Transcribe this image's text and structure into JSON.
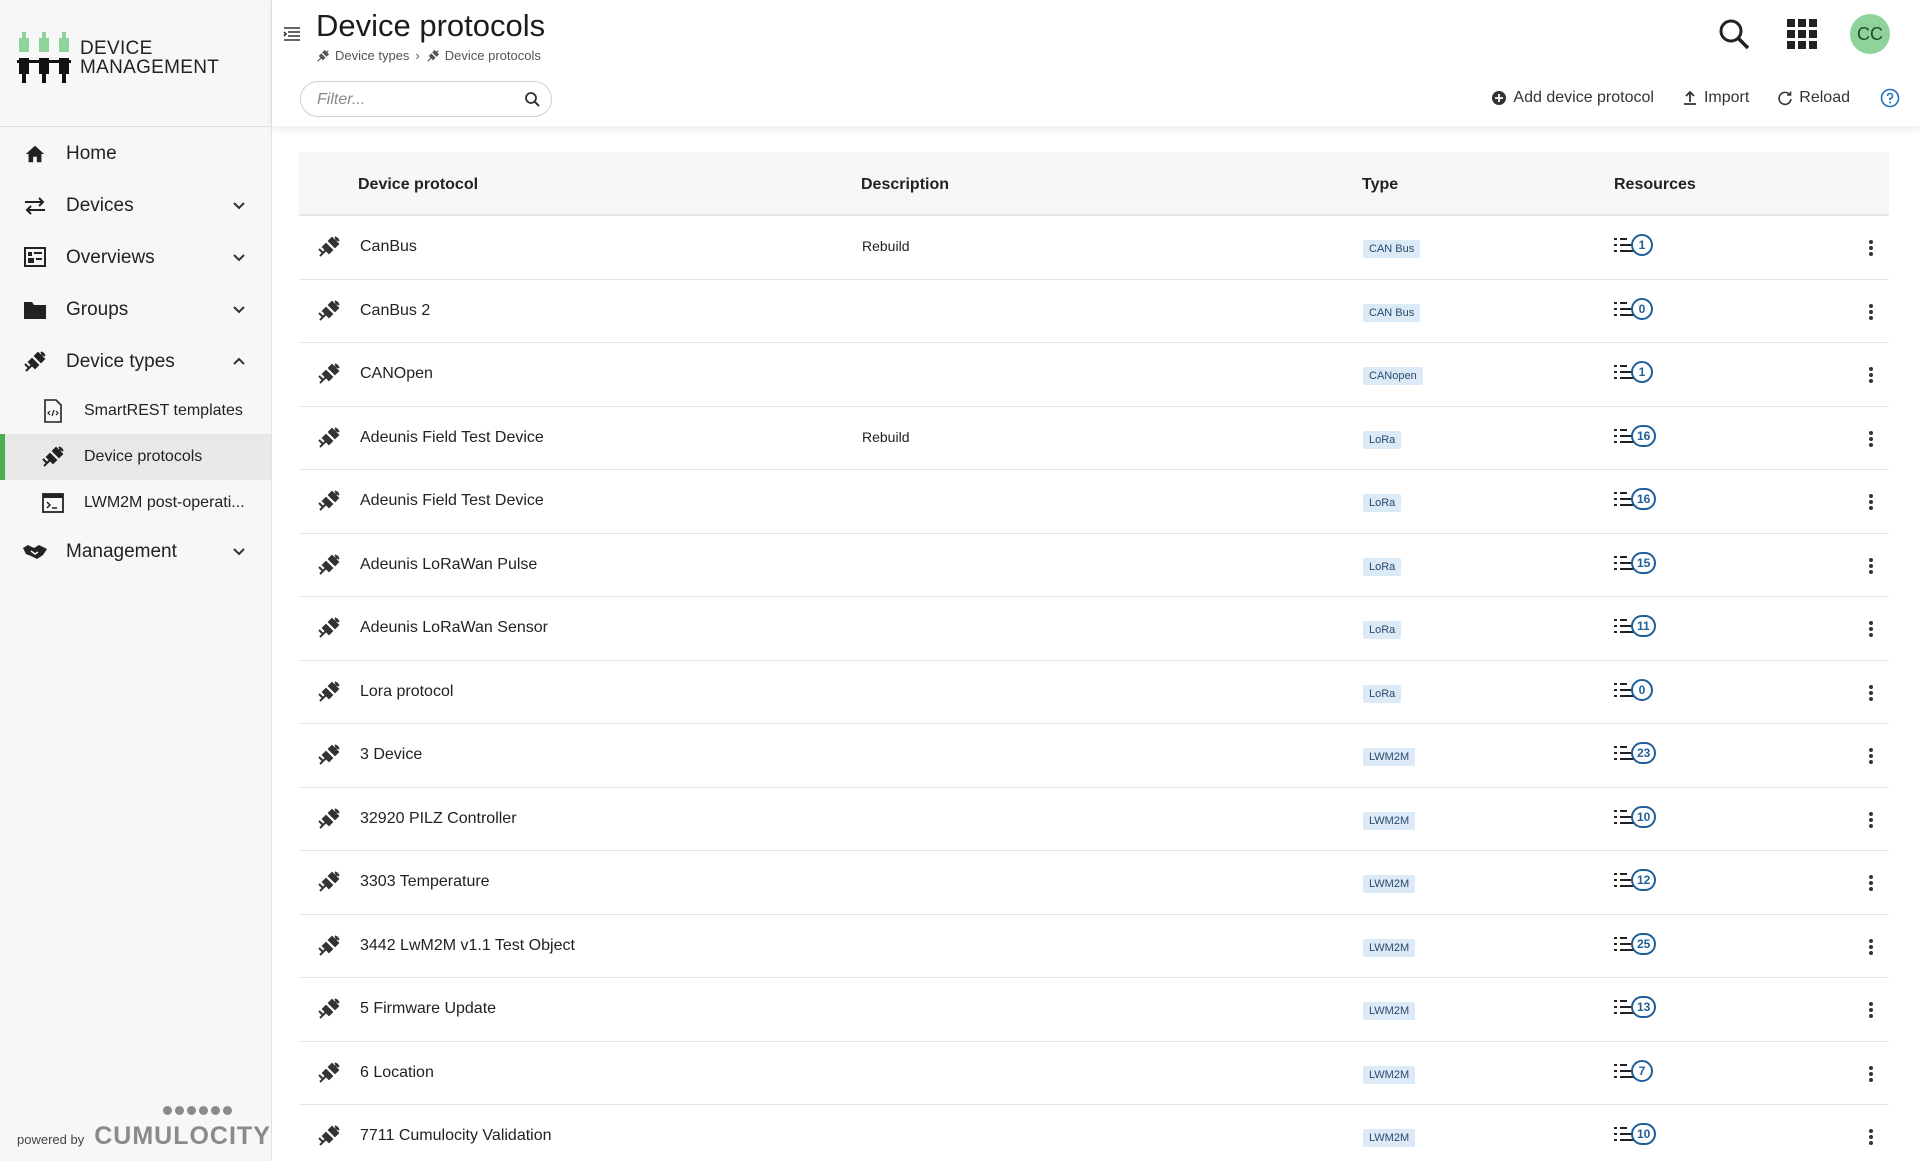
{
  "app": {
    "logo_line1": "DEVICE",
    "logo_line2": "MANAGEMENT",
    "powered_by": "powered by",
    "brand": "CUMULOCITY",
    "accent_color": "#4caf50"
  },
  "sidebar": {
    "items": [
      {
        "label": "Home",
        "icon": "home-icon"
      },
      {
        "label": "Devices",
        "icon": "swap-arrows-icon"
      },
      {
        "label": "Overviews",
        "icon": "dashboard-icon"
      },
      {
        "label": "Groups",
        "icon": "folder-icon"
      },
      {
        "label": "Device types",
        "icon": "device-type-icon"
      },
      {
        "label": "SmartREST templates",
        "icon": "code-file-icon"
      },
      {
        "label": "Device protocols",
        "icon": "device-protocol-icon"
      },
      {
        "label": "LWM2M post-operati...",
        "icon": "terminal-icon"
      },
      {
        "label": "Management",
        "icon": "handshake-icon"
      }
    ]
  },
  "header": {
    "title": "Device protocols",
    "breadcrumb": [
      "Device types",
      "Device protocols"
    ],
    "avatar_initials": "CC",
    "filter_placeholder": "Filter...",
    "actions": {
      "add": "Add device protocol",
      "import": "Import",
      "reload": "Reload"
    }
  },
  "table": {
    "columns": [
      "Device protocol",
      "Description",
      "Type",
      "Resources"
    ],
    "rows": [
      {
        "name": "CanBus",
        "description": "Rebuild",
        "type": "CAN Bus",
        "resources": "1"
      },
      {
        "name": "CanBus 2",
        "description": "",
        "type": "CAN Bus",
        "resources": "0"
      },
      {
        "name": "CANOpen",
        "description": "",
        "type": "CANopen",
        "resources": "1"
      },
      {
        "name": "Adeunis Field Test Device",
        "description": "Rebuild",
        "type": "LoRa",
        "resources": "16"
      },
      {
        "name": "Adeunis Field Test Device",
        "description": "",
        "type": "LoRa",
        "resources": "16"
      },
      {
        "name": "Adeunis LoRaWan Pulse",
        "description": "",
        "type": "LoRa",
        "resources": "15"
      },
      {
        "name": "Adeunis LoRaWan Sensor",
        "description": "",
        "type": "LoRa",
        "resources": "11"
      },
      {
        "name": "Lora protocol",
        "description": "",
        "type": "LoRa",
        "resources": "0"
      },
      {
        "name": "3 Device",
        "description": "",
        "type": "LWM2M",
        "resources": "23"
      },
      {
        "name": "32920 PILZ Controller",
        "description": "",
        "type": "LWM2M",
        "resources": "10"
      },
      {
        "name": "3303 Temperature",
        "description": "",
        "type": "LWM2M",
        "resources": "12"
      },
      {
        "name": "3442 LwM2M v1.1 Test Object",
        "description": "",
        "type": "LWM2M",
        "resources": "25"
      },
      {
        "name": "5 Firmware Update",
        "description": "",
        "type": "LWM2M",
        "resources": "13"
      },
      {
        "name": "6 Location",
        "description": "",
        "type": "LWM2M",
        "resources": "7"
      },
      {
        "name": "7711 Cumulocity Validation",
        "description": "",
        "type": "LWM2M",
        "resources": "10"
      }
    ]
  }
}
